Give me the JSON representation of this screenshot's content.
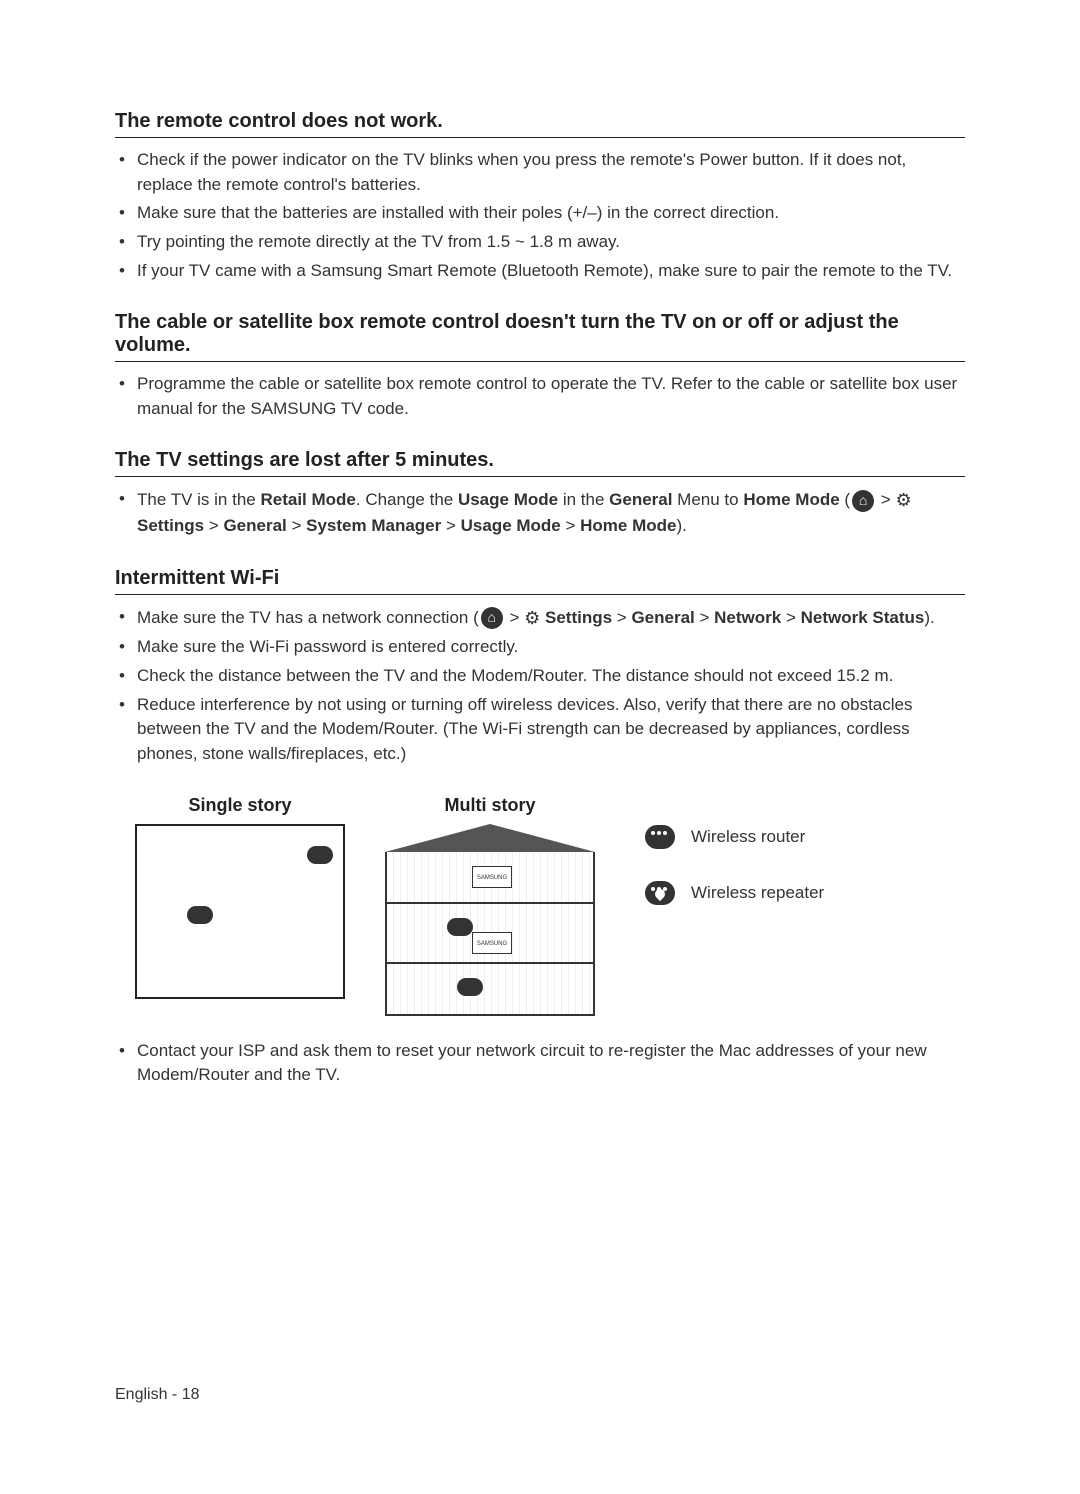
{
  "sections": [
    {
      "title": "The remote control does not work.",
      "items": [
        [
          {
            "t": "Check if the power indicator on the TV blinks when you press the remote's Power button. If it does not, replace the remote control's batteries."
          }
        ],
        [
          {
            "t": "Make sure that the batteries are installed with their poles (+/–) in the correct direction."
          }
        ],
        [
          {
            "t": "Try pointing the remote directly at the TV from 1.5 ~ 1.8 m away."
          }
        ],
        [
          {
            "t": "If your TV came with a Samsung Smart Remote (Bluetooth Remote), make sure to pair the remote to the TV."
          }
        ]
      ]
    },
    {
      "title": "The cable or satellite box remote control doesn't turn the TV on or off or adjust the volume.",
      "items": [
        [
          {
            "t": "Programme the cable or satellite box remote control to operate the TV. Refer to the cable or satellite box user manual for the SAMSUNG TV code."
          }
        ]
      ]
    },
    {
      "title": "The TV settings are lost after 5 minutes.",
      "items": [
        [
          {
            "t": "The TV is in the "
          },
          {
            "b": "Retail Mode"
          },
          {
            "t": ". Change the "
          },
          {
            "b": "Usage Mode"
          },
          {
            "t": " in the "
          },
          {
            "b": "General"
          },
          {
            "t": " Menu to "
          },
          {
            "b": "Home Mode"
          },
          {
            "t": " ("
          },
          {
            "icon": "home"
          },
          {
            "t": " > "
          },
          {
            "icon": "gear"
          },
          {
            "t": " "
          },
          {
            "b": "Settings"
          },
          {
            "t": " > "
          },
          {
            "b": "General"
          },
          {
            "t": " > "
          },
          {
            "b": "System Manager"
          },
          {
            "t": " > "
          },
          {
            "b": "Usage Mode"
          },
          {
            "t": " > "
          },
          {
            "b": "Home Mode"
          },
          {
            "t": ")."
          }
        ]
      ]
    },
    {
      "title": "Intermittent Wi-Fi",
      "items": [
        [
          {
            "t": "Make sure the TV has a network connection ("
          },
          {
            "icon": "home"
          },
          {
            "t": " > "
          },
          {
            "icon": "gear"
          },
          {
            "t": " "
          },
          {
            "b": "Settings"
          },
          {
            "t": " > "
          },
          {
            "b": "General"
          },
          {
            "t": " > "
          },
          {
            "b": "Network"
          },
          {
            "t": " > "
          },
          {
            "b": "Network Status"
          },
          {
            "t": ")."
          }
        ],
        [
          {
            "t": "Make sure the Wi-Fi password is entered correctly."
          }
        ],
        [
          {
            "t": "Check the distance between the TV and the Modem/Router. The distance should not exceed 15.2 m."
          }
        ],
        [
          {
            "t": "Reduce interference by not using or turning off wireless devices. Also, verify that there are no obstacles between the TV and the Modem/Router. (The Wi-Fi strength can be decreased by appliances, cordless phones, stone walls/fireplaces, etc.)"
          }
        ]
      ]
    }
  ],
  "diagram": {
    "single_label": "Single story",
    "multi_label": "Multi story",
    "legend_router": "Wireless router",
    "legend_repeater": "Wireless repeater"
  },
  "post_diagram_item": [
    {
      "t": "Contact your ISP and ask them to reset your network circuit to re-register the Mac addresses of your new Modem/Router and the TV."
    }
  ],
  "footer": "English - 18"
}
